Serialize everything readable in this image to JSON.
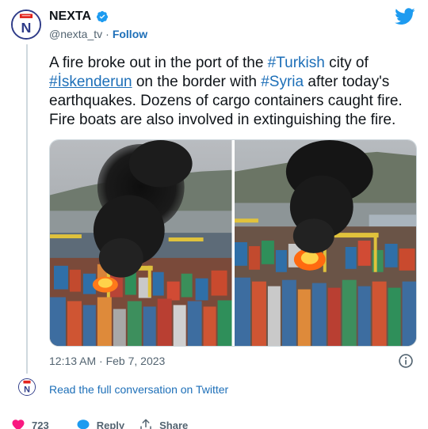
{
  "account": {
    "display_name": "NEXTA",
    "handle": "@nexta_tv",
    "separator": "·",
    "follow_label": "Follow",
    "logo_letter": "N"
  },
  "tweet": {
    "segments": [
      {
        "text": "A fire broke out in the port of the ",
        "type": "text"
      },
      {
        "text": "#Turkish",
        "type": "hashtag"
      },
      {
        "text": " city of ",
        "type": "text"
      },
      {
        "text": "#İskenderun",
        "type": "hashtag"
      },
      {
        "text": " on the border with ",
        "type": "text"
      },
      {
        "text": "#Syria",
        "type": "hashtag"
      },
      {
        "text": " after today's earthquakes. Dozens of cargo containers caught fire. Fire boats are also involved in extinguishing the fire.",
        "type": "text"
      }
    ],
    "timestamp": "12:13 AM · Feb 7, 2023"
  },
  "conversation_link": "Read the full conversation on Twitter",
  "actions": {
    "likes": "723",
    "reply_label": "Reply",
    "share_label": "Share"
  },
  "colors": {
    "accent": "#1d9bf0",
    "link": "#1d6fb8",
    "heart": "#f91880",
    "brand_red": "#e3231c",
    "brand_navy": "#2e3b88"
  },
  "icons": [
    "verified-badge-icon",
    "twitter-bird-icon",
    "info-icon",
    "heart-icon",
    "reply-bubble-icon",
    "share-icon"
  ]
}
